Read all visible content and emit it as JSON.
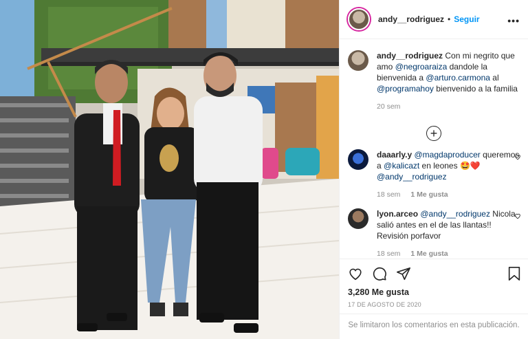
{
  "post": {
    "username": "andy__rodriguez",
    "follow_label": "Seguir",
    "separator": "•",
    "more_label": "•••"
  },
  "caption": {
    "username": "andy__rodriguez",
    "text_1": "Con mi negrito que amo ",
    "mention_1": "@negroaraiza",
    "text_2": " dandole la bienvenida a ",
    "mention_2": "@arturo.carmona",
    "text_3": " al ",
    "mention_3": "@programahoy",
    "text_4": " bienvenido a la familia",
    "time": "20 sem"
  },
  "load_more": "+",
  "comments": [
    {
      "username": "daaarly.y",
      "mention_a": "@magdaproducer",
      "text_a": " queremos a ",
      "mention_b": "@kalicazt",
      "text_b": " en leones ",
      "emoji": "🤩❤️",
      "mention_c": "@andy__rodriguez",
      "time": "18 sem",
      "likes": "1 Me gusta"
    },
    {
      "username": "lyon.arceo",
      "mention_a": "@andy__rodriguez",
      "text_a": " Nicola salió antes en el de las llantas!! Revisión porfavor",
      "time": "18 sem",
      "likes": "1 Me gusta"
    }
  ],
  "stats": {
    "likes": "3,280 Me gusta",
    "date": "17 DE AGOSTO DE 2020",
    "comments_limited": "Se limitaron los comentarios en esta publicación."
  },
  "icons": {
    "like": "heart-icon",
    "comment": "comment-icon",
    "share": "share-icon",
    "save": "bookmark-icon"
  }
}
